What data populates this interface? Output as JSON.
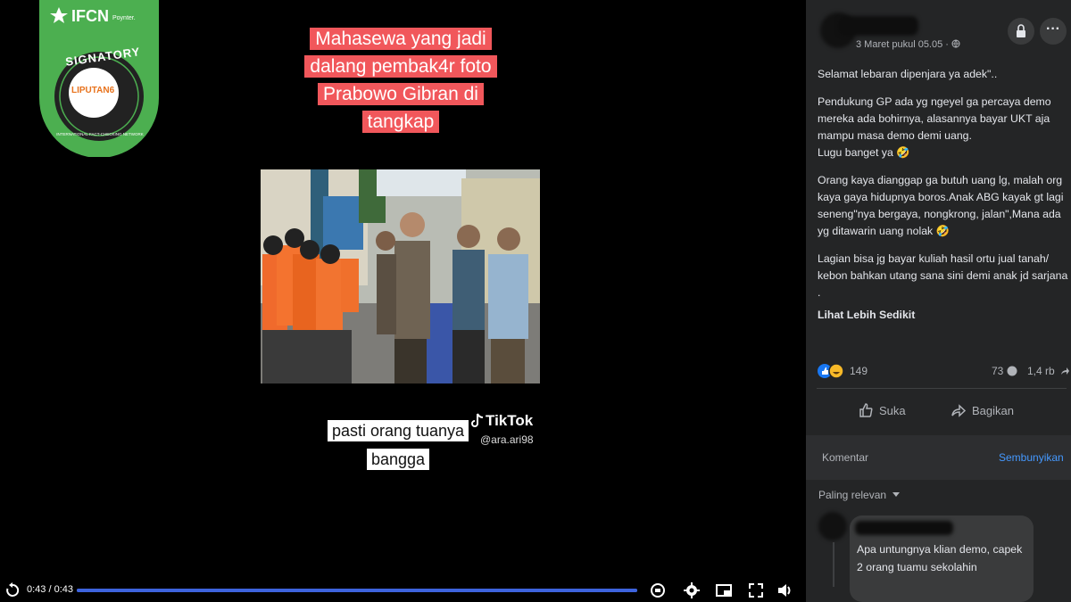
{
  "video": {
    "badge": {
      "brand": "IFCN",
      "poynter": "Poynter.",
      "ring_top": "SIGNATORY",
      "ring_bottom": "INTERNATIONAL FACT-CHECKING NETWORK",
      "publisher": "LIPUTAN6",
      "ring_color": "#4caf50"
    },
    "caption_top": "Mahasewa yang jadi dalang pembak4r foto Prabowo Gibran di tangkap",
    "caption_bottom": "pasti orang tuanya bangga",
    "tiktok": {
      "name": "TikTok",
      "handle": "@ara.ari98"
    },
    "controls": {
      "time": "0:43 / 0:43",
      "progress": 1.0,
      "icons": [
        "replay-icon",
        "captions-icon",
        "settings-icon",
        "pip-icon",
        "fullscreen-icon",
        "volume-icon"
      ]
    }
  },
  "post": {
    "meta": "3 Maret pukul 05.05 · ",
    "privacy_icon": "globe-icon",
    "paragraphs": [
      "Selamat lebaran dipenjara ya adek\"..",
      "Pendukung GP ada yg ngeyel ga percaya demo mereka ada bohirnya, alasannya bayar UKT aja mampu masa demo demi uang.\nLugu banget ya 🤣",
      "Orang kaya dianggap ga butuh uang lg, malah org kaya gaya hidupnya boros.Anak ABG kayak gt lagi seneng\"nya bergaya, nongkrong, jalan\",Mana ada yg ditawarin uang nolak 🤣",
      "Lagian bisa jg bayar kuliah hasil ortu jual tanah/ kebon bahkan utang sana sini demi anak jd sarjana ."
    ],
    "see_less": "Lihat Lebih Sedikit",
    "reactions_count": "149",
    "comments_count": "73",
    "shares_count": "1,4 rb",
    "like_label": "Suka",
    "share_label": "Bagikan"
  },
  "comments": {
    "tab": "Komentar",
    "hide": "Sembunyikan",
    "sort": "Paling relevan",
    "first_comment_text": "Apa untungnya klian demo, capek 2 orang tuamu sekolahin"
  }
}
